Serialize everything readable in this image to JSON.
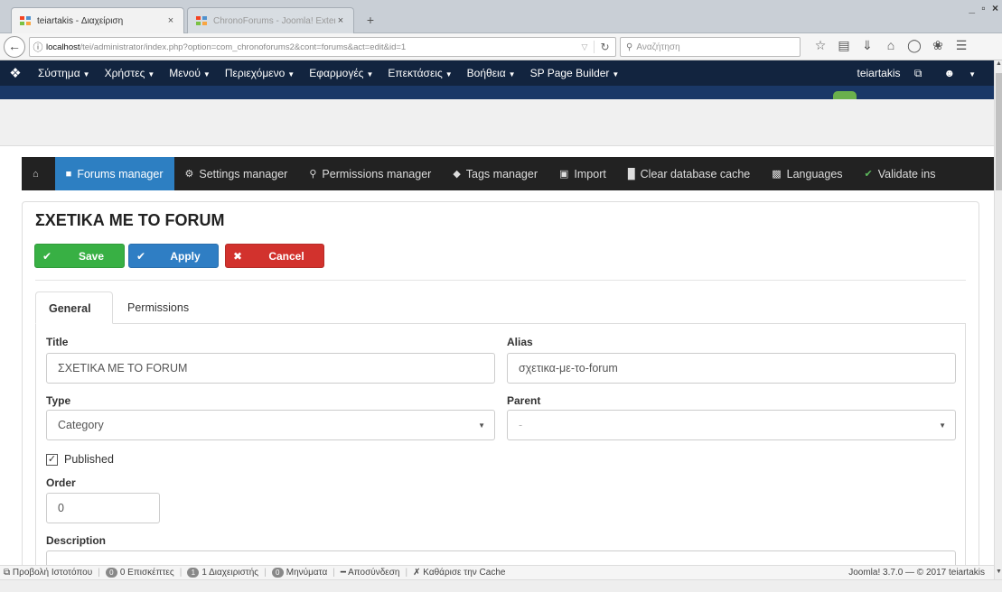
{
  "browser": {
    "tabs": [
      {
        "title": "teiartakis - Διαχείριση",
        "close": "×"
      },
      {
        "title": "ChronoForums - Joomla! Extens",
        "close": "×"
      }
    ],
    "new_tab": "+",
    "window_controls": "_ ▫ ×",
    "url_host": "localhost",
    "url_path": "/tei/administrator/index.php?option=com_chronoforums2&cont=forums&act=edit&id=1",
    "search_placeholder": "Αναζήτηση"
  },
  "admin_menu": {
    "items": [
      "Σύστημα",
      "Χρήστες",
      "Μενού",
      "Περιεχόμενο",
      "Εφαρμογές",
      "Επεκτάσεις",
      "Βοήθεια",
      "SP Page Builder"
    ],
    "user": "teiartakis"
  },
  "cf_nav": {
    "items": [
      {
        "label": "",
        "icon": "home-icon"
      },
      {
        "label": "Forums manager",
        "icon": "folder-icon"
      },
      {
        "label": "Settings manager",
        "icon": "cogs-icon"
      },
      {
        "label": "Permissions manager",
        "icon": "key-icon"
      },
      {
        "label": "Tags manager",
        "icon": "tag-icon"
      },
      {
        "label": "Import",
        "icon": "hdd-icon"
      },
      {
        "label": "Clear database cache",
        "icon": "trash-icon"
      },
      {
        "label": "Languages",
        "icon": "language-icon"
      },
      {
        "label": "Validate ins",
        "icon": "check-icon"
      }
    ]
  },
  "form": {
    "title": "ΣΧΕΤΙΚΑ ΜΕ ΤΟ FORUM",
    "buttons": {
      "save": "Save",
      "apply": "Apply",
      "cancel": "Cancel"
    },
    "tabs": {
      "general": "General",
      "permissions": "Permissions"
    },
    "title_label": "Title",
    "title_value": "ΣΧΕΤΙΚΑ ΜΕ ΤΟ FORUM",
    "alias_label": "Alias",
    "alias_value": "σχετικα-με-το-forum",
    "type_label": "Type",
    "type_value": "Category",
    "parent_label": "Parent",
    "parent_value": "-",
    "published_label": "Published",
    "published_checked": true,
    "order_label": "Order",
    "order_value": "0",
    "description_label": "Description"
  },
  "status_bar": {
    "view_site": "Προβολή Ιστοτόπου",
    "visitors_count": "0",
    "visitors": "0 Επισκέπτες",
    "admins_count": "1",
    "admins": "1 Διαχειριστής",
    "messages_count": "0",
    "messages": "Μηνύματα",
    "logout": "Αποσύνδεση",
    "clear_cache": "Καθάρισε την Cache",
    "version": "Joomla! 3.7.0 — © 2017 teiartakis"
  }
}
